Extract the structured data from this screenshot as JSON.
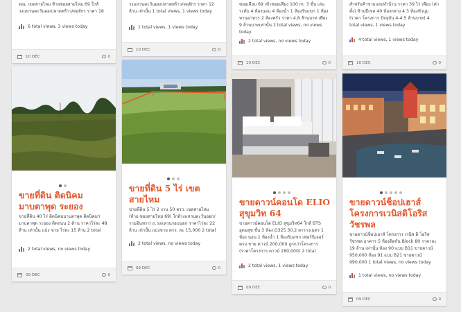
{
  "cards": [
    {
      "top_desc": "ตณ. เขตสายไหม ท้ายซอยสายไหม 69 ใกล้ วงแหวนตะวันออก/ลาดพร้าว/จตุจักร ราคา 18 ล้าน",
      "top_stats": "6 total views, 3 views today",
      "top_date": "10 DEC",
      "top_comments": "0",
      "title": "ขายที่ดิน ติดนิคม มาบตาพุด ระยอง",
      "desc": "ขายที่ดิน 40 ไร่ ติดนิคมมาบตาพุด ติดนิคมฯ มาบตาพุด ระยอง ติดถนน 2 ด้าน ราคาไร่ละ 48 ล้าน เท่านั้น แบ่ง ขาย ไร่ละ 15 ล้าน 2 total views, no views today",
      "stats": "2 total views, no views today",
      "date": "09 DEC",
      "comments": "0"
    },
    {
      "top_desc": "วงแหวนตะวันออก/ลาดพร้าว/จตุจักร ราคา 12 ล้าน เท่านั้น 1 total views, 1 views today",
      "top_stats": "1 total views, 1 views today",
      "top_date": "10 DEC",
      "top_comments": "0",
      "title": "ขายที่ดิน 5 ไร่ เขต สายไหม",
      "desc": "ขายที่ดิน 5 ไร่ 2 งาน 50 ตรว. เขตสายไหม (ท้าย ซอยสายไหม 69) ใกล้วงแหวนตะวันออก/รามอินทรา/ ถ.วงแหวนรอบนอก ราคาไร่ละ 22 ล้าน เท่านั้น แบ่งขาย ตรว. ละ 15,000 2 total views, no views today",
      "stats": "2 total views, no views today",
      "date": "09 DEC",
      "comments": "0"
    },
    {
      "top_desc": "ซอยเลียบ 69 เข้าซอยเพียง 100 m. 3 ชั้น เล่น ระดับ 4 ห้องนอน 4 ห้องน้ำ 1 ห้องรับแขก 1 ห้อง ทานอาหาร 2 ห้องครัว ราคา 4.8 ล้านบาท เพียง 9 ล้านบาทเท่านั้น 2 total views, no views today",
      "top_stats": "2 total views, no views today",
      "top_date": "10 DEC",
      "top_comments": "0",
      "title": "ขายดาวน์คอนโด ELIO สุขุมวิท 64",
      "desc": "ขายดาวน์คอนโด ELIO สุขุมวิท64 ใกล้ BTS อุดมสุข ชั้น 3 ห้อง D325 30.2 ตารางเมตร 1 ห้อง นอน 1 ห้องน้ำ 1 ห้องรับแขก เฟอร์นิเจอร์ครบ ขาย ดาวน์ 200,000 ถูกกว่าโครงการ (ราคาโครงการ ดาวน์ 280,000) 2 total views, 1 views today",
      "stats": "2 total views, 1 views today",
      "date": "09 DEC",
      "comments": "0"
    },
    {
      "top_desc": "สำหรับค้าขายและทำบ้าน ราคา 39 ไร่ เพียง (ค่าตั้ง) ห้ามมีเขต 40 ห้องกลาง 4.3 ห้องหัวมุม (ราคา โครงการ ปัจจุบัน 4-4.5 ล้านบาท) 4 total views, 1 views today",
      "top_stats": "4 total views, 1 views today",
      "top_date": "10 DEC",
      "top_comments": "0",
      "title": "ขายดาวน์ช็อปเฮาส์ โครงการเวนิสดิโอริส วัชรพล",
      "desc": "ขายดาวน์ช็อปเฮาส์ โครงการ เวนิส ดิ โอริส วัชรพล อาคาร 5 ห้องติดกัน Block 80 ราคาละ 19 ล้าน เท่านั้น ห้อง 90 แบบ B11 ขายดาวน์ 950,000 ห้อง 91 แบบ B21 ขายดาวน์ 990,000 1 total views, no views today",
      "stats": "1 total views, no views today",
      "date": "09 DEC",
      "comments": "0"
    }
  ]
}
